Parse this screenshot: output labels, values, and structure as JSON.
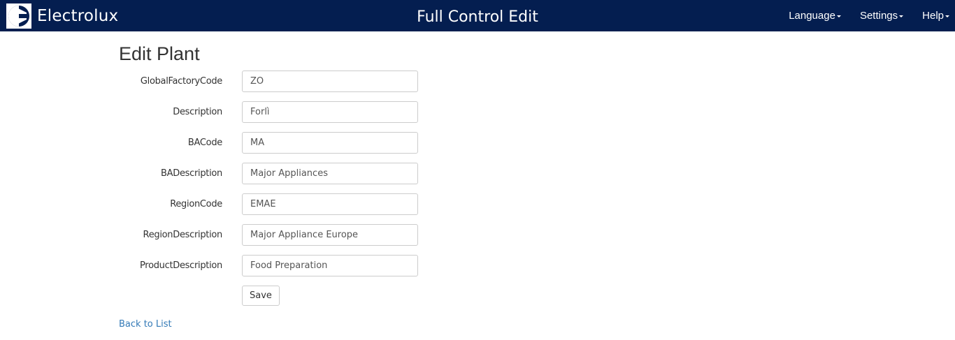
{
  "header": {
    "brand_name": "Electrolux",
    "brand_icon": "electrolux-logo",
    "title": "Full Control Edit",
    "menu": [
      {
        "label": "Language"
      },
      {
        "label": "Settings"
      },
      {
        "label": "Help"
      }
    ],
    "background_color": "#041e50"
  },
  "page": {
    "title": "Edit Plant"
  },
  "form": {
    "fields": [
      {
        "label": "GlobalFactoryCode",
        "value": "ZO"
      },
      {
        "label": "Description",
        "value": "Forlì"
      },
      {
        "label": "BACode",
        "value": "MA"
      },
      {
        "label": "BADescription",
        "value": "Major Appliances"
      },
      {
        "label": "RegionCode",
        "value": "EMAE"
      },
      {
        "label": "RegionDescription",
        "value": "Major Appliance Europe"
      },
      {
        "label": "ProductDescription",
        "value": "Food Preparation"
      }
    ],
    "save_label": "Save"
  },
  "links": {
    "back_label": "Back to List",
    "link_color": "#337ab7"
  }
}
